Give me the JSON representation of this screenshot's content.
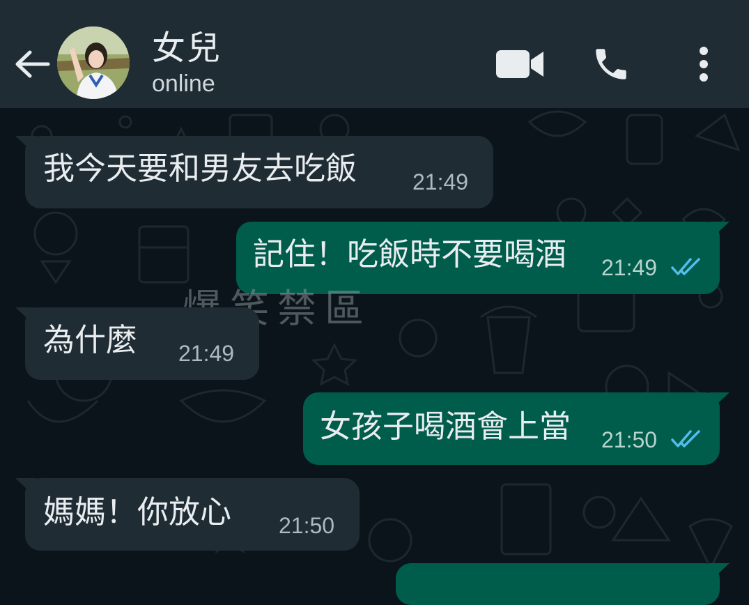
{
  "header": {
    "back_icon": "arrow-left-icon",
    "contact_name": "女兒",
    "status": "online",
    "video_icon": "video-camera-icon",
    "call_icon": "phone-icon",
    "menu_icon": "more-vertical-icon",
    "background_color": "#1f2c34"
  },
  "messages": [
    {
      "direction": "incoming",
      "text": "我今天要和男友去吃飯",
      "time": "21:49"
    },
    {
      "direction": "outgoing",
      "text": "記住！吃飯時不要喝酒",
      "time": "21:49",
      "status": "read"
    },
    {
      "direction": "incoming",
      "text": "為什麼",
      "time": "21:49"
    },
    {
      "direction": "outgoing",
      "text": "女孩子喝酒會上當",
      "time": "21:50",
      "status": "read"
    },
    {
      "direction": "incoming",
      "text": "媽媽！你放心",
      "time": "21:50"
    }
  ],
  "watermark": "爆笑禁區",
  "colors": {
    "chat_background": "#0b141a",
    "incoming_bubble": "#1f2c34",
    "outgoing_bubble": "#005c4b",
    "read_tick": "#53bdeb"
  }
}
